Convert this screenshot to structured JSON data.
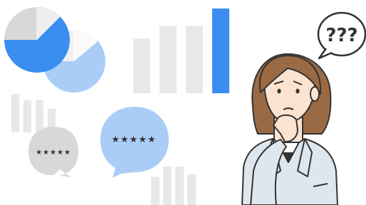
{
  "colors": {
    "blue": "#3a8ef0",
    "light_blue": "#a9cdf7",
    "grey": "#9a9a9a",
    "light_grey": "#e6e6e6",
    "pale_grey": "#f0f0f0",
    "bubble_grey": "#d8d8d8",
    "hair": "#9a6a44",
    "skin": "#fbe3cf",
    "jacket": "#dfe7ee",
    "ink": "#333333"
  },
  "illustration": {
    "rating_bubble_small_stars": "★★★★★",
    "rating_bubble_large_stars": "★★★★★",
    "thought_bubble_text": "???"
  },
  "chart_data": [
    {
      "type": "pie",
      "values": [
        75,
        25
      ],
      "colors": [
        "#3a8ef0",
        "#d8d8d8"
      ]
    },
    {
      "type": "pie",
      "values": [
        75,
        25
      ],
      "colors": [
        "#a9cdf7",
        "#f0f0f0"
      ]
    },
    {
      "type": "bar",
      "values": [
        0.6,
        0.74,
        0.74,
        0.93
      ],
      "highlight_index": 3
    },
    {
      "type": "bar",
      "values": [
        0.9,
        0.75,
        0.75,
        0.55
      ]
    },
    {
      "type": "bar",
      "values": [
        0.55,
        0.75,
        0.75,
        0.6
      ]
    }
  ]
}
